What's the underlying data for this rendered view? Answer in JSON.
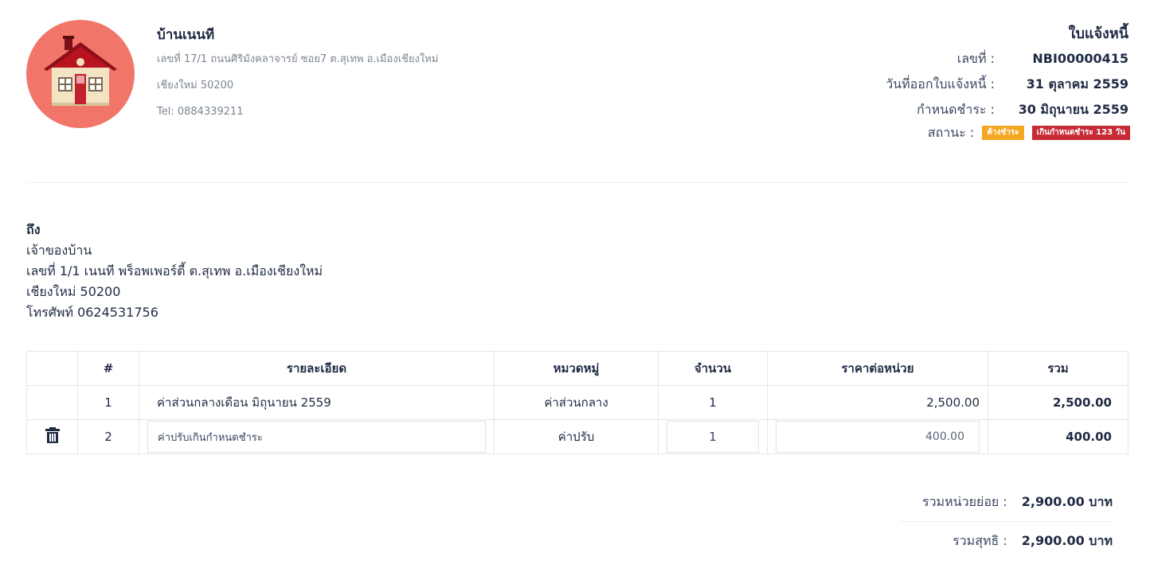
{
  "company": {
    "name": "บ้านเนนที",
    "address": "เลขที่ 17/1 ถนนศิริมังคลาจารย์ ซอย7 ต.สุเทพ อ.เมืองเชียงใหม่",
    "city": "เชียงใหม่ 50200",
    "tel": "Tel: 0884339211"
  },
  "invoice": {
    "title": "ใบแจ้งหนี้",
    "number_label": "เลขที่ :",
    "number": "NBI00000415",
    "issue_label": "วันที่ออกใบแจ้งหนี้ :",
    "issue_date": "31 ตุลาคม 2559",
    "due_label": "กำหนดชำระ :",
    "due_date": "30 มิถุนายน 2559",
    "status_label": "สถานะ :",
    "status_badge": "ค้างชำระ",
    "overdue_badge": "เกินกำหนดชำระ 123 วัน",
    "status_color": "#f5a623",
    "overdue_color": "#c62b36"
  },
  "bill_to": {
    "label": "ถึง",
    "name": "เจ้าของบ้าน",
    "address": "เลขที่ 1/1 เนนที พร็อพเพอร์ตี้ ต.สุเทพ อ.เมืองเชียงใหม่",
    "city": "เชียงใหม่ 50200",
    "phone": "โทรศัพท์ 0624531756"
  },
  "table": {
    "headers": {
      "no": "#",
      "desc": "รายละเอียด",
      "category": "หมวดหมู่",
      "qty": "จำนวน",
      "unit_price": "ราคาต่อหน่วย",
      "total": "รวม"
    },
    "rows": [
      {
        "no": "1",
        "desc": "ค่าส่วนกลางเดือน มิถุนายน 2559",
        "category": "ค่าส่วนกลาง",
        "qty": "1",
        "unit_price": "2,500.00",
        "total": "2,500.00"
      },
      {
        "no": "2",
        "desc": "ค่าปรับเกินกำหนดชำระ",
        "category": "ค่าปรับ",
        "qty": "1",
        "unit_price": "400.00",
        "total": "400.00"
      }
    ]
  },
  "totals": {
    "subtotal_label": "รวมหน่วยย่อย :",
    "subtotal": "2,900.00 บาท",
    "net_label": "รวมสุทธิ :",
    "net": "2,900.00 บาท"
  },
  "icons": {
    "logo": "house-icon",
    "delete": "trash-icon"
  }
}
